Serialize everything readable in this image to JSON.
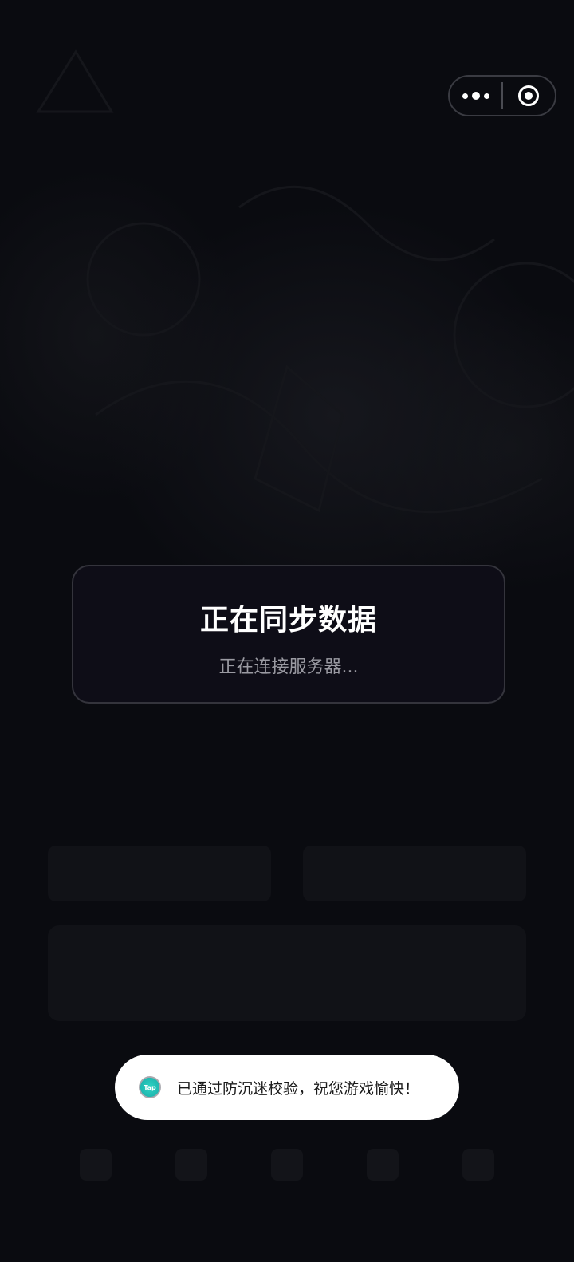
{
  "capsule": {
    "more_icon": "more-dots-icon",
    "close_icon": "target-circle-icon"
  },
  "sync_dialog": {
    "title": "正在同步数据",
    "subtitle": "正在连接服务器..."
  },
  "toast": {
    "icon": "taptap-logo-icon",
    "icon_text": "Tap",
    "message": "已通过防沉迷校验，祝您游戏愉快！"
  },
  "colors": {
    "background": "#0a0b10",
    "dialog_background": "#0e0d17",
    "dialog_border": "#34343c",
    "toast_background": "#ffffff",
    "accent_teal": "#2fd4c4"
  }
}
